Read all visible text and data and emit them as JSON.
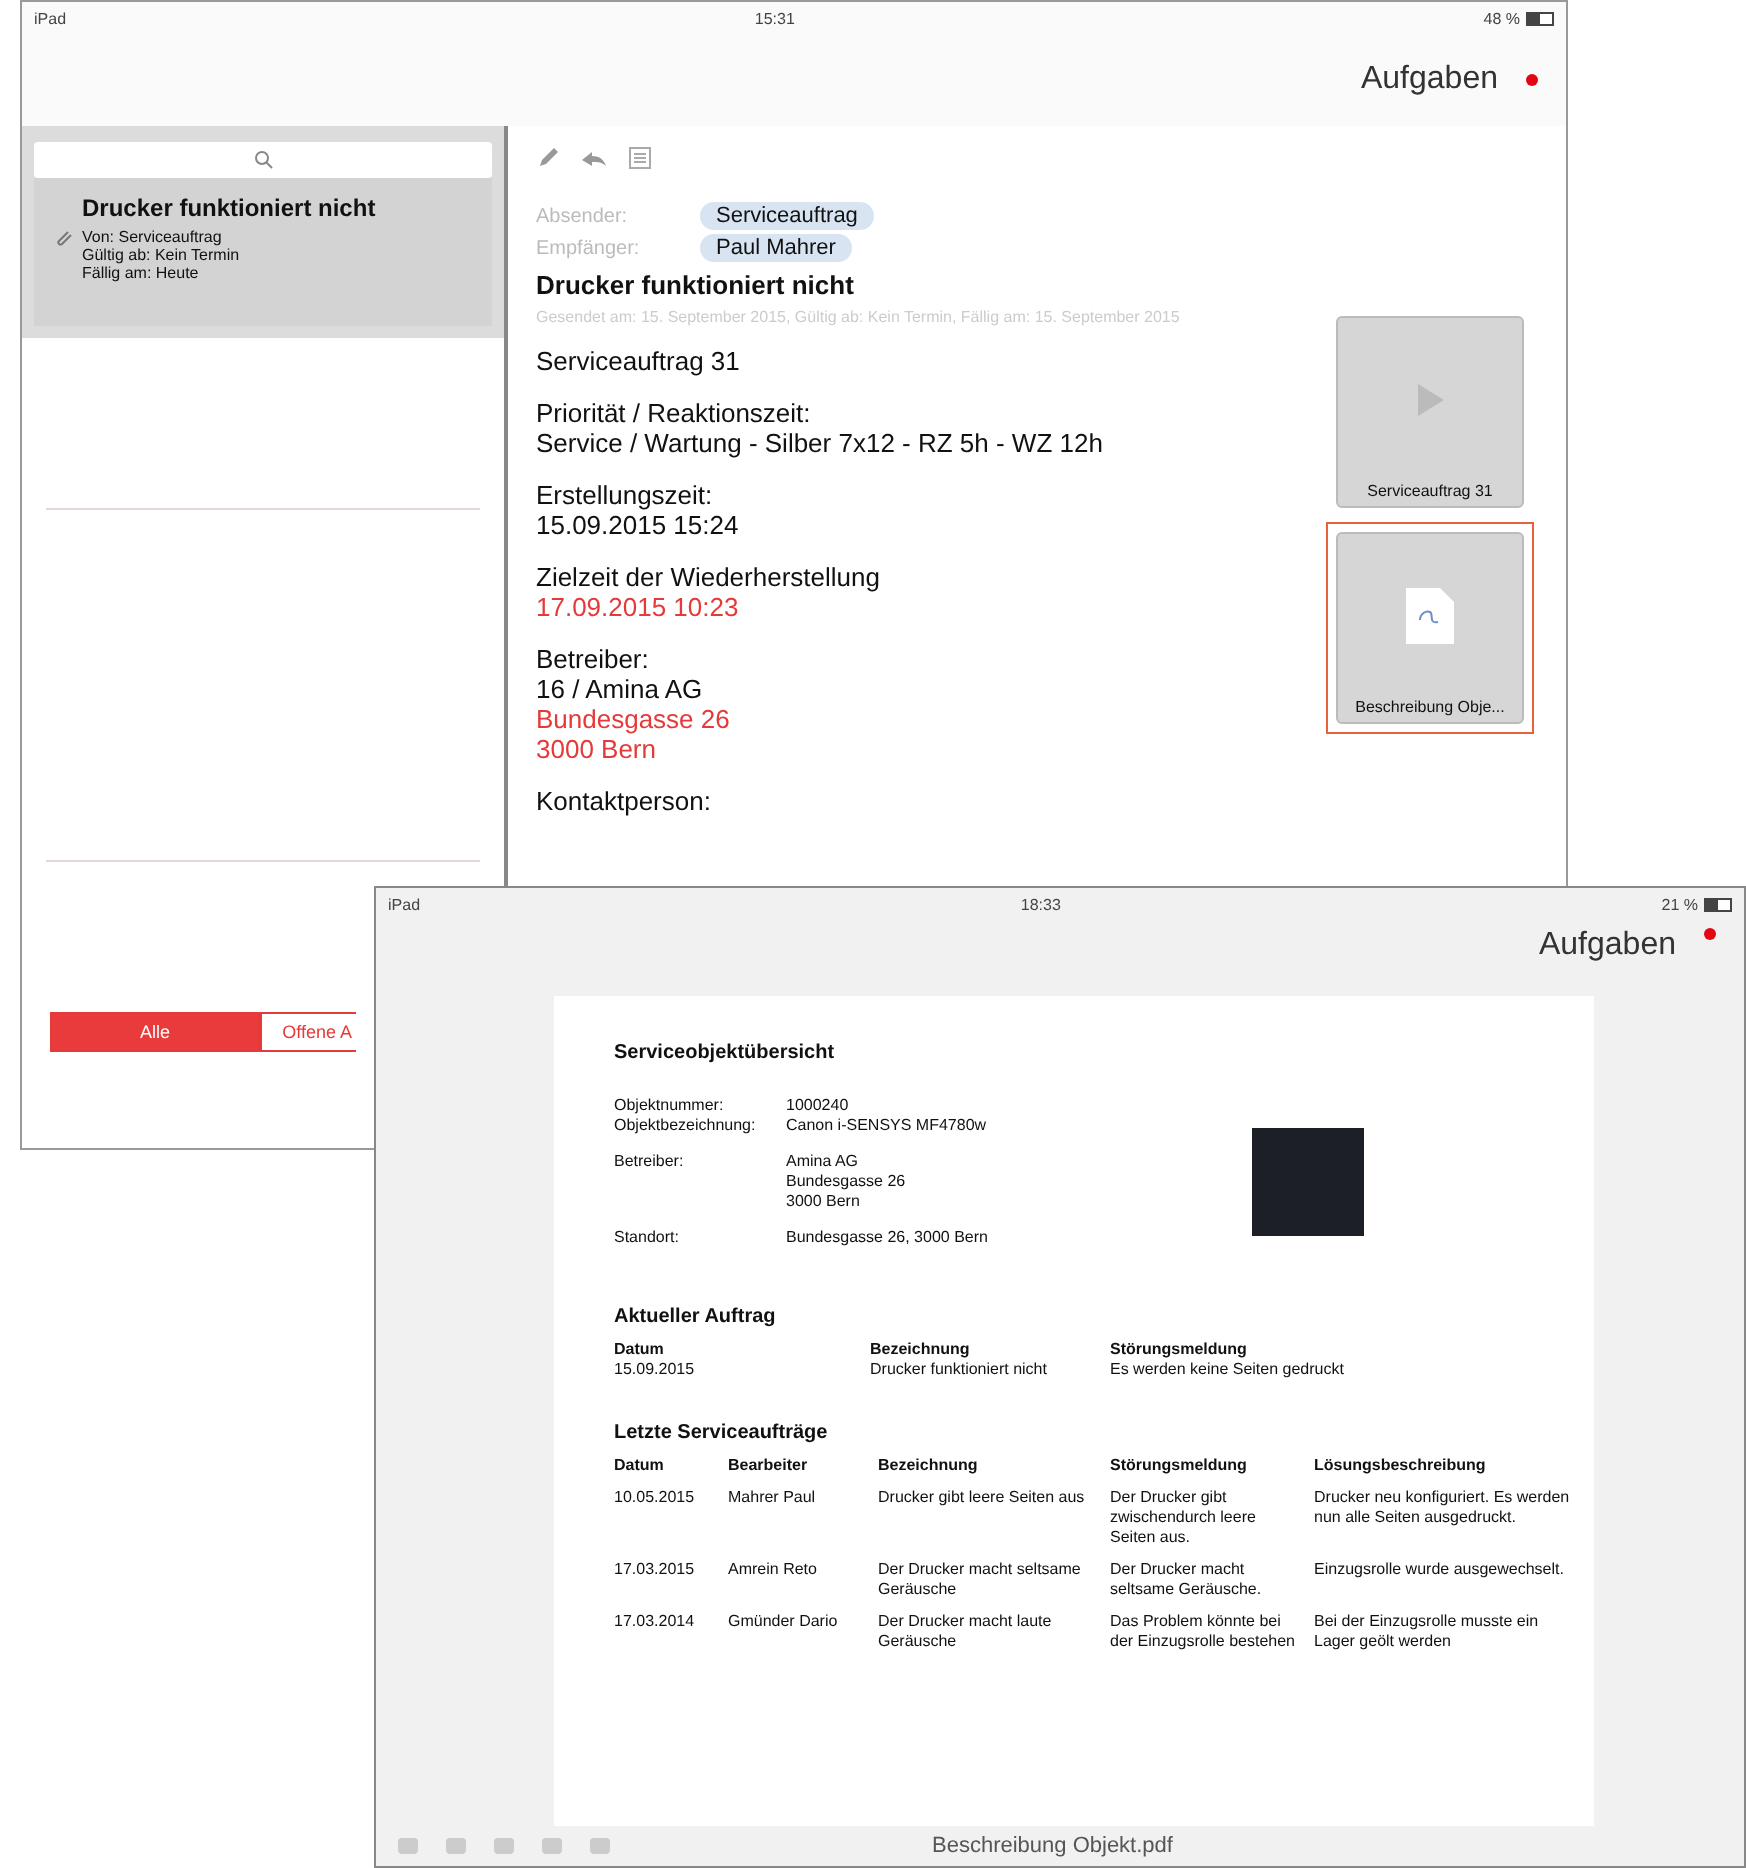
{
  "back_screen": {
    "status_bar": {
      "device": "iPad",
      "time": "15:31",
      "battery": "48 %"
    },
    "nav": {
      "title": "Aufgaben"
    },
    "sidebar": {
      "items": [
        {
          "title": "Drucker funktioniert nicht",
          "lines": [
            "Von: Serviceauftrag",
            "Gültig ab: Kein Termin",
            "Fällig am: Heute"
          ],
          "selected": true
        }
      ],
      "filter_tabs": [
        {
          "label": "Alle",
          "selected": true
        },
        {
          "label": "Offene A",
          "selected": false
        }
      ]
    },
    "detail": {
      "sender_label": "Absender:",
      "sender": "Serviceauftrag",
      "recipient_label": "Empfänger:",
      "recipient": "Paul Mahrer",
      "subject": "Drucker funktioniert nicht",
      "meta": "Gesendet am: 15. September 2015, Gültig ab: Kein Termin, Fällig am: 15. September 2015",
      "blocks": [
        {
          "lines": [
            {
              "text": "Serviceauftrag 31",
              "alert": false
            }
          ]
        },
        {
          "lines": [
            {
              "text": "Priorität / Reaktionszeit:",
              "alert": false
            },
            {
              "text": "Service / Wartung - Silber 7x12 - RZ 5h - WZ 12h",
              "alert": false
            }
          ]
        },
        {
          "lines": [
            {
              "text": "Erstellungszeit:",
              "alert": false
            },
            {
              "text": "15.09.2015 15:24",
              "alert": false
            }
          ]
        },
        {
          "lines": [
            {
              "text": "Zielzeit der Wiederherstellung",
              "alert": false
            },
            {
              "text": "17.09.2015 10:23",
              "alert": true
            }
          ]
        },
        {
          "lines": [
            {
              "text": "Betreiber:",
              "alert": false
            },
            {
              "text": "16 / Amina AG",
              "alert": false
            },
            {
              "text": "Bundesgasse 26",
              "alert": true
            },
            {
              "text": "3000 Bern",
              "alert": true
            }
          ]
        },
        {
          "lines": [
            {
              "text": "Kontaktperson:",
              "alert": false
            }
          ]
        }
      ],
      "attachments": [
        {
          "label": "Serviceauftrag 31",
          "kind": "video",
          "selected": false
        },
        {
          "label": "Beschreibung Obje...",
          "kind": "pdf",
          "selected": true
        }
      ]
    }
  },
  "front_screen": {
    "status_bar": {
      "device": "iPad",
      "time": "18:33",
      "battery": "21 %"
    },
    "nav": {
      "title": "Aufgaben"
    },
    "document": {
      "title": "Serviceobjektübersicht",
      "object_groups": [
        [
          {
            "label": "Objektnummer:",
            "lines": [
              "1000240"
            ]
          },
          {
            "label": "Objektbezeichnung:",
            "lines": [
              "Canon i-SENSYS MF4780w"
            ]
          }
        ],
        [
          {
            "label": "Betreiber:",
            "lines": [
              "Amina AG",
              "Bundesgasse 26",
              "3000 Bern"
            ]
          }
        ],
        [
          {
            "label": "Standort:",
            "lines": [
              "Bundesgasse 26, 3000 Bern"
            ]
          }
        ]
      ],
      "current_order": {
        "heading": "Aktueller Auftrag",
        "columns": [
          "Datum",
          "Bezeichnung",
          "Störungsmeldung"
        ],
        "row": [
          "15.09.2015",
          "Drucker funktioniert nicht",
          "Es werden keine Seiten gedruckt"
        ]
      },
      "recent_orders": {
        "heading": "Letzte Serviceaufträge",
        "columns": [
          "Datum",
          "Bearbeiter",
          "Bezeichnung",
          "Störungsmeldung",
          "Lösungsbeschreibung"
        ],
        "rows": [
          [
            "10.05.2015",
            "Mahrer Paul",
            "Drucker gibt leere Seiten aus",
            "Der Drucker gibt zwischendurch leere Seiten aus.",
            "Drucker neu konfiguriert. Es werden nun alle Seiten ausgedruckt."
          ],
          [
            "17.03.2015",
            "Amrein Reto",
            "Der Drucker macht seltsame Geräusche",
            "Der Drucker macht seltsame Geräusche.",
            "Einzugsrolle wurde ausgewechselt."
          ],
          [
            "17.03.2014",
            "Gmünder Dario",
            "Der Drucker macht laute Geräusche",
            "Das Problem könnte bei der Einzugsrolle bestehen",
            "Bei der Einzugsrolle musste ein Lager geölt werden"
          ]
        ]
      }
    },
    "toolbar": {
      "filename": "Beschreibung Objekt.pdf"
    }
  }
}
